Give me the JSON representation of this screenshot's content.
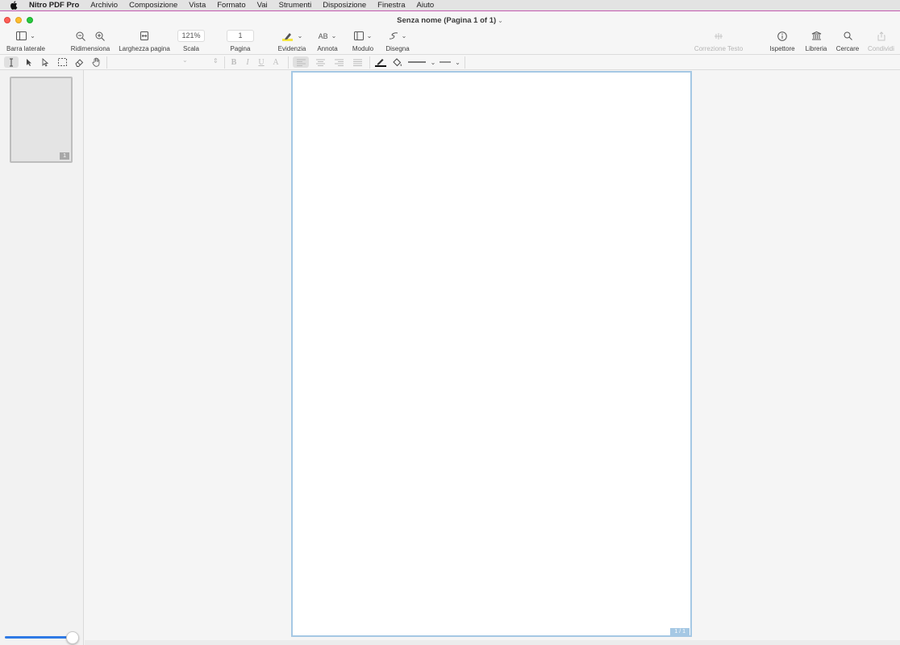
{
  "menubar": {
    "app": "Nitro PDF Pro",
    "items": [
      "Archivio",
      "Composizione",
      "Vista",
      "Formato",
      "Vai",
      "Strumenti",
      "Disposizione",
      "Finestra",
      "Aiuto"
    ]
  },
  "window": {
    "title": "Senza nome (Pagina 1 of 1)"
  },
  "toolbar": {
    "sidebar_label": "Barra laterale",
    "resize_label": "Ridimensiona",
    "page_width_label": "Larghezza pagina",
    "scale_value": "121%",
    "scale_label": "Scala",
    "page_value": "1",
    "page_label": "Pagina",
    "highlight_label": "Evidenzia",
    "annotate_icon_text": "AB",
    "annotate_label": "Annota",
    "form_label": "Modulo",
    "draw_label": "Disegna",
    "text_correction_label": "Correzione Testo",
    "inspector_label": "Ispettore",
    "library_label": "Libreria",
    "search_label": "Cercare",
    "share_label": "Condividi"
  },
  "formatbar": {
    "bold": "B",
    "italic": "I",
    "underline": "U",
    "text_a": "A"
  },
  "sidebar": {
    "thumb_number": "1"
  },
  "document": {
    "page_indicator": "1 / 1"
  },
  "colors": {
    "accent": "#2f7ae5",
    "page_border": "#a5c8e4",
    "highlight_yellow": "#f5e642"
  }
}
